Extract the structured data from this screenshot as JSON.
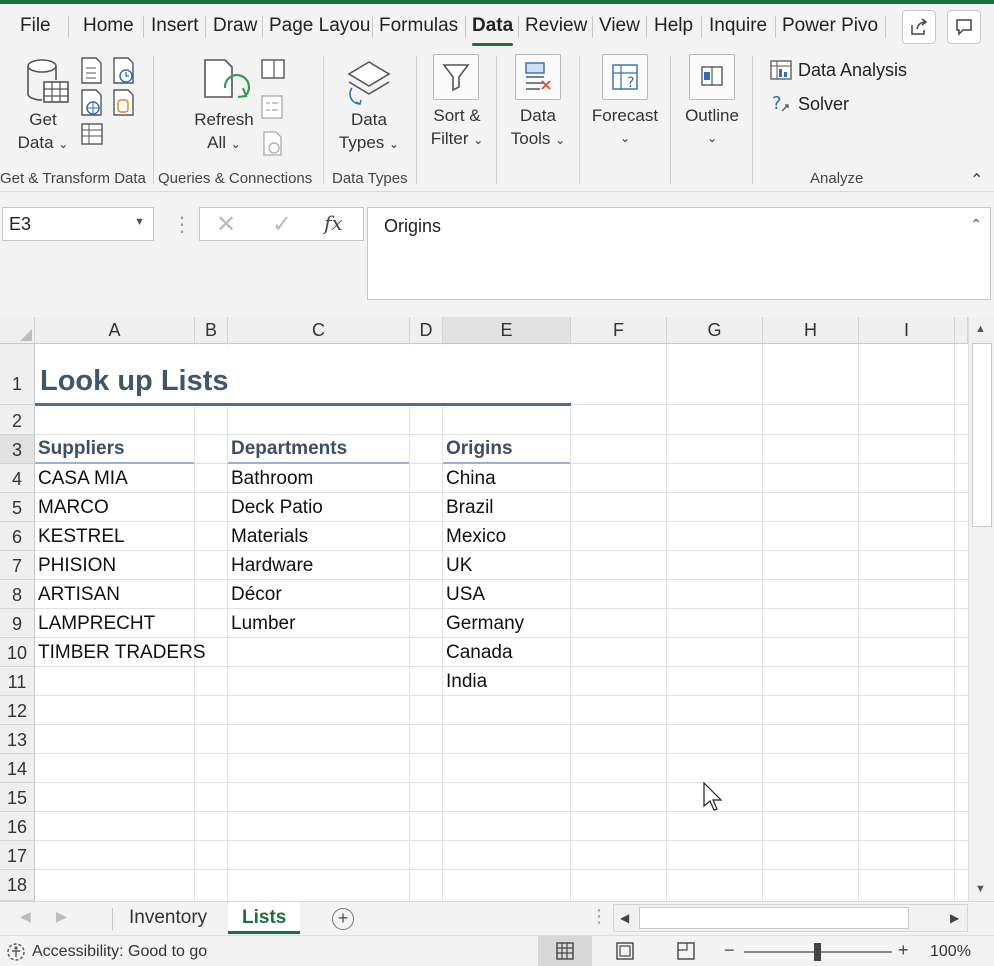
{
  "menu": {
    "tabs": [
      "File",
      "Home",
      "Insert",
      "Draw",
      "Page Layou",
      "Formulas",
      "Data",
      "Review",
      "View",
      "Help",
      "Inquire",
      "Power Pivo"
    ],
    "active": "Data"
  },
  "ribbon": {
    "get_data": {
      "line1": "Get",
      "line2": "Data"
    },
    "refresh_all": {
      "line1": "Refresh",
      "line2": "All"
    },
    "data_types": {
      "line1": "Data",
      "line2": "Types"
    },
    "sort_filter": {
      "line1": "Sort &",
      "line2": "Filter"
    },
    "data_tools": {
      "line1": "Data",
      "line2": "Tools"
    },
    "forecast": {
      "line1": "Forecast"
    },
    "outline": {
      "line1": "Outline"
    },
    "data_analysis": "Data Analysis",
    "solver": "Solver",
    "groups": {
      "get_transform": "Get & Transform Data",
      "queries": "Queries & Connections",
      "data_types": "Data Types",
      "analyze": "Analyze"
    }
  },
  "formula_bar": {
    "name_box": "E3",
    "fx": "fx",
    "formula": "Origins"
  },
  "grid": {
    "columns": [
      "A",
      "B",
      "C",
      "D",
      "E",
      "F",
      "G",
      "H",
      "I"
    ],
    "rows": [
      "1",
      "2",
      "3",
      "4",
      "5",
      "6",
      "7",
      "8",
      "9",
      "10",
      "11",
      "12",
      "13",
      "14",
      "15",
      "16",
      "17",
      "18"
    ],
    "title": "Look up Lists",
    "suppliers_header": "Suppliers",
    "departments_header": "Departments",
    "origins_header": "Origins",
    "suppliers": [
      "CASA MIA",
      "MARCO",
      "KESTREL",
      "PHISION",
      "ARTISAN",
      "LAMPRECHT",
      "TIMBER TRADERS"
    ],
    "departments": [
      "Bathroom",
      "Deck Patio",
      "Materials",
      "Hardware",
      "Décor",
      "Lumber"
    ],
    "origins": [
      "China",
      "Brazil",
      "Mexico",
      "UK",
      "USA",
      "Germany",
      "Canada",
      "India"
    ]
  },
  "sheets": {
    "tabs": [
      "Inventory",
      "Lists"
    ],
    "active": "Lists"
  },
  "status": {
    "accessibility": "Accessibility: Good to go",
    "zoom": "100%"
  },
  "colors": {
    "accent_green": "#1e6e42",
    "header_text": "#3c4f67",
    "title_text": "#3e566f",
    "underline_blue": "#4a6fa5"
  }
}
